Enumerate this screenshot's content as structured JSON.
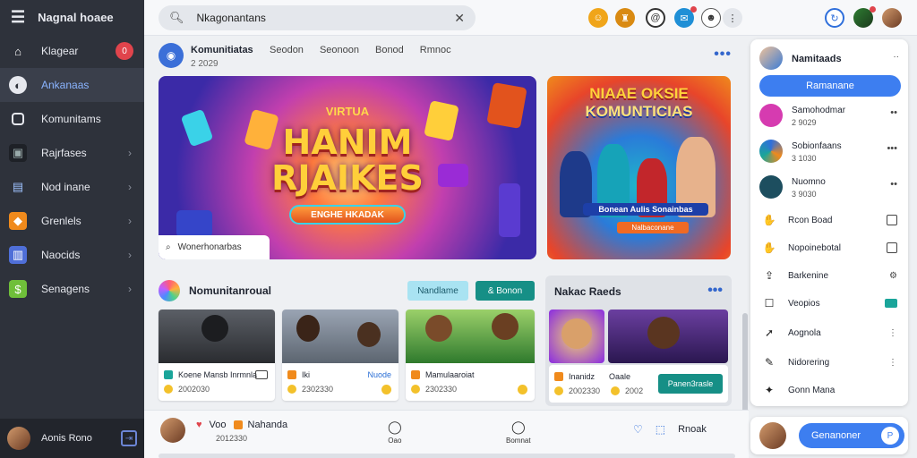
{
  "sidebar": {
    "title": "Nagnal hoaee",
    "items": [
      {
        "label": "Klagear",
        "icon": "home-icon",
        "badge": "0"
      },
      {
        "label": "Ankanaas",
        "icon": "explore-icon"
      },
      {
        "label": "Komunitams",
        "icon": "square-icon"
      },
      {
        "label": "Rajrfases",
        "icon": "screen-icon"
      },
      {
        "label": "Nod inane",
        "icon": "clipboard-icon"
      },
      {
        "label": "Grenlels",
        "icon": "orange-app-icon"
      },
      {
        "label": "Naocids",
        "icon": "document-icon"
      },
      {
        "label": "Senagens",
        "icon": "money-icon"
      }
    ],
    "footer": {
      "user": "Aonis Rono",
      "icon": "exit-icon"
    }
  },
  "topbar": {
    "search_value": "Nkagonantans",
    "icons": [
      "emoji-icon",
      "trophy-icon",
      "at-icon",
      "chat-icon",
      "face-icon",
      "more-vertical-icon",
      "refresh-icon",
      "profile-icon",
      "profile-icon"
    ]
  },
  "post": {
    "author": "Komunitiatas",
    "time": "2 2029",
    "tabs": [
      "Seodon",
      "Seonoon",
      "Bonod",
      "Rmnoc"
    ]
  },
  "banner_left": {
    "small": "VIRTUA",
    "title1": "HANIM",
    "title2": "RJAIKES",
    "cta": "ENGHE HKADAK",
    "search": "Wonerhonarbas"
  },
  "banner_right": {
    "title1": "NIAAE OKSIE",
    "title2": "KOMUNTICIAS",
    "caption": "Bonean Aulis Sonainbas",
    "caption2": "Nalbaconane"
  },
  "community": {
    "title": "Nomunitanroual",
    "btn_light": "Nandlame",
    "btn_teal": "& Bonon",
    "cards": [
      {
        "name": "Koene Mansb Inrmnla",
        "meta": "2002030",
        "tag": ""
      },
      {
        "name": "Iki",
        "meta": "2302330",
        "tag": "Nuode"
      },
      {
        "name": "Mamulaaroiat",
        "meta": "2302330",
        "tag": ""
      }
    ]
  },
  "side_panel": {
    "title": "Nakac Raeds",
    "card_name": "Inanidz",
    "card_meta": "2002330",
    "card_label": "Oaale",
    "card_meta2": "2002",
    "button": "Panen3rasle"
  },
  "bottom": {
    "user_line": "Voo",
    "user_tag": "Nahanda",
    "sub": "2012330",
    "nav1": "Oao",
    "nav2": "Bomnat",
    "action": "Rnoak"
  },
  "right_panel": {
    "user": "Namitaads",
    "close": "··",
    "button": "Ramanane",
    "rows": [
      {
        "name": "Samohodmar",
        "time": "2 9029",
        "action": "••"
      },
      {
        "name": "Sobionfaans",
        "time": "3 1030",
        "action": "•••"
      },
      {
        "name": "Nuomno",
        "time": "3 9030",
        "action": "••"
      }
    ],
    "links": [
      {
        "label": "Rcon Boad",
        "icon": "thumb-icon"
      },
      {
        "label": "Nopoinebotal",
        "icon": "thumb-icon"
      },
      {
        "label": "Barkenine",
        "icon": "upload-icon"
      },
      {
        "label": "Veopios",
        "icon": "square-icon"
      },
      {
        "label": "Aognola",
        "icon": "cursor-icon"
      },
      {
        "label": "Nidorering",
        "icon": "edit-icon"
      },
      {
        "label": "Gonn Mana",
        "icon": "game-icon"
      }
    ],
    "footer_button": "Genanoner",
    "footer_icon": "P"
  },
  "colors": {
    "sidebar": "#2e323b",
    "accent": "#3d7ef0",
    "teal": "#168f86",
    "badge": "#e0444c"
  }
}
